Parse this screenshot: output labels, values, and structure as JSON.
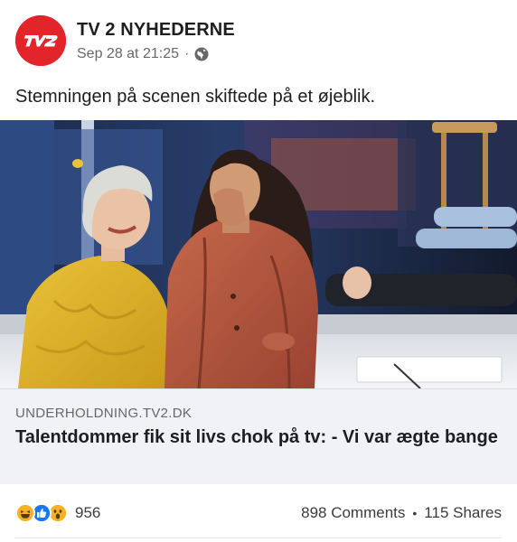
{
  "post": {
    "page_name": "TV 2 NYHEDERNE",
    "timestamp": "Sep 28 at 21:25",
    "audience_icon": "globe-icon",
    "caption": "Stemningen på scenen skiftede på et øjeblik.",
    "avatar_logo": "TV2"
  },
  "link_preview": {
    "domain": "UNDERHOLDNING.TV2.DK",
    "headline": "Talentdommer fik sit livs chok på tv: - Vi var ægte bange"
  },
  "stats": {
    "reaction_icons": [
      "haha-icon",
      "like-icon",
      "wow-icon"
    ],
    "reaction_count": "956",
    "comments": "898 Comments",
    "shares": "115 Shares"
  },
  "colors": {
    "brand_red": "#e3242b",
    "like_blue": "#1877f2",
    "reaction_yellow": "#f7b125",
    "link_box_bg": "#f0f2f5"
  }
}
